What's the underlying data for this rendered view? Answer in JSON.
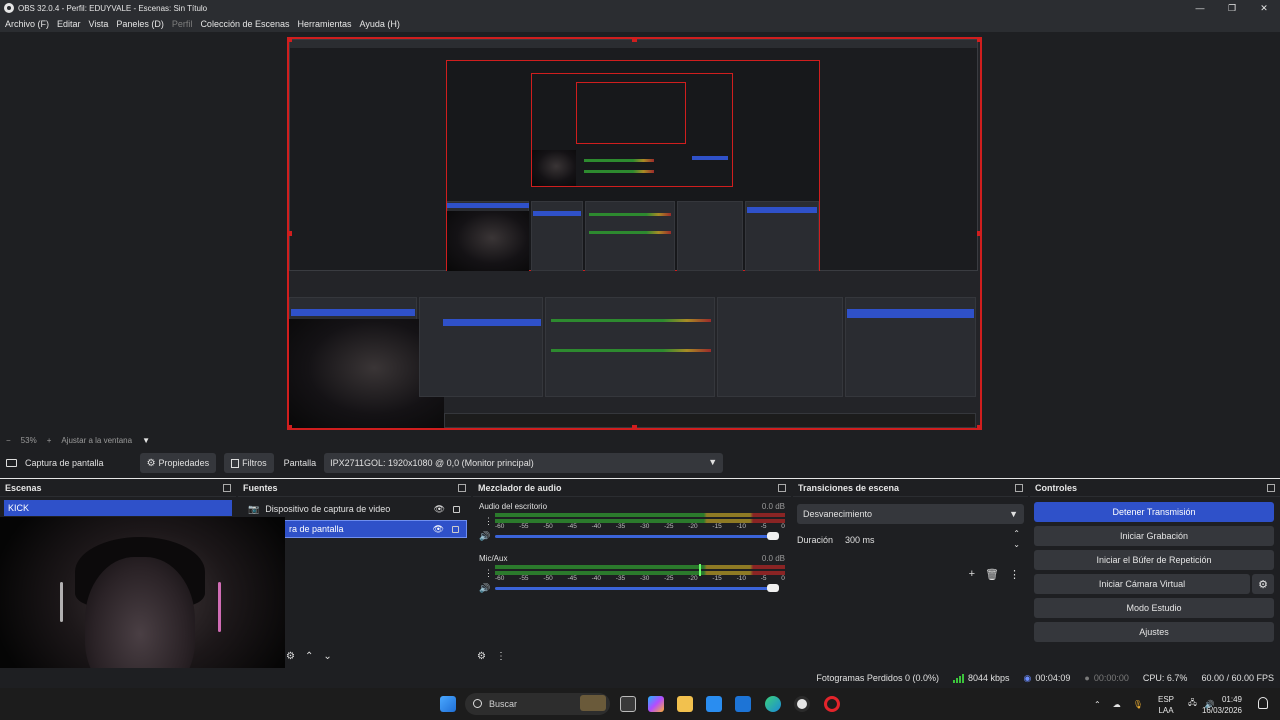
{
  "window": {
    "title": "OBS 32.0.4 - Perfil: EDUYVALE - Escenas: Sin Título"
  },
  "window_controls": {
    "minimize": "—",
    "maximize": "❐",
    "close": "✕"
  },
  "menu": [
    {
      "label": "Archivo (F)",
      "enabled": true
    },
    {
      "label": "Editar",
      "enabled": true
    },
    {
      "label": "Vista",
      "enabled": true
    },
    {
      "label": "Paneles (D)",
      "enabled": true
    },
    {
      "label": "Perfil",
      "enabled": false
    },
    {
      "label": "Colección de Escenas",
      "enabled": true
    },
    {
      "label": "Herramientas",
      "enabled": true
    },
    {
      "label": "Ayuda (H)",
      "enabled": true
    }
  ],
  "preview": {
    "zoom_minus": "−",
    "zoom": "53%",
    "zoom_plus": "+",
    "fit_label": "Ajustar a la ventana",
    "fit_chevron": "▼"
  },
  "source_toolbar": {
    "source_name": "Captura de pantalla",
    "properties": "Propiedades",
    "filters": "Filtros",
    "display_label": "Pantalla",
    "display_value": "IPX2711GOL: 1920x1080 @ 0,0 (Monitor principal)"
  },
  "scenes": {
    "title": "Escenas",
    "items": [
      "KICK"
    ]
  },
  "sources": {
    "title": "Fuentes",
    "items": [
      {
        "label": "Dispositivo de captura de video",
        "selected": false
      },
      {
        "label": "ra de pantalla",
        "selected": true
      }
    ]
  },
  "mixer": {
    "title": "Mezclador de audio",
    "channels": [
      {
        "name": "Audio del escritorio",
        "db": "0.0 dB",
        "level": 0.0
      },
      {
        "name": "Mic/Aux",
        "db": "0.0 dB",
        "level": 0.67
      }
    ],
    "scale": [
      "-60",
      "-55",
      "-50",
      "-45",
      "-40",
      "-35",
      "-30",
      "-25",
      "-20",
      "-15",
      "-10",
      "-5",
      "0"
    ]
  },
  "transitions": {
    "title": "Transiciones de escena",
    "selected": "Desvanecimiento",
    "duration_label": "Duración",
    "duration_value": "300 ms"
  },
  "controls": {
    "title": "Controles",
    "stop_stream": "Detener Transmisión",
    "start_recording": "Iniciar Grabación",
    "replay_buffer": "Iniciar el Búfer de Repetición",
    "virtual_camera": "Iniciar Cámara Virtual",
    "studio_mode": "Modo Estudio",
    "settings": "Ajustes"
  },
  "status": {
    "dropped_frames": "Fotogramas Perdidos 0 (0.0%)",
    "bitrate": "8044 kbps",
    "stream_time": "00:04:09",
    "record_time": "00:00:00",
    "cpu": "CPU: 6.7%",
    "fps": "60.00 / 60.00 FPS"
  },
  "taskbar": {
    "search_placeholder": "Buscar",
    "lang_top": "ESP",
    "lang_bottom": "LAA",
    "time": "01:49",
    "date": "16/03/2026"
  },
  "colors": {
    "accent": "#2f51c9",
    "selection_outline": "#d01e1e",
    "panel_bg": "#1e1f22",
    "button_bg": "#35373c"
  }
}
